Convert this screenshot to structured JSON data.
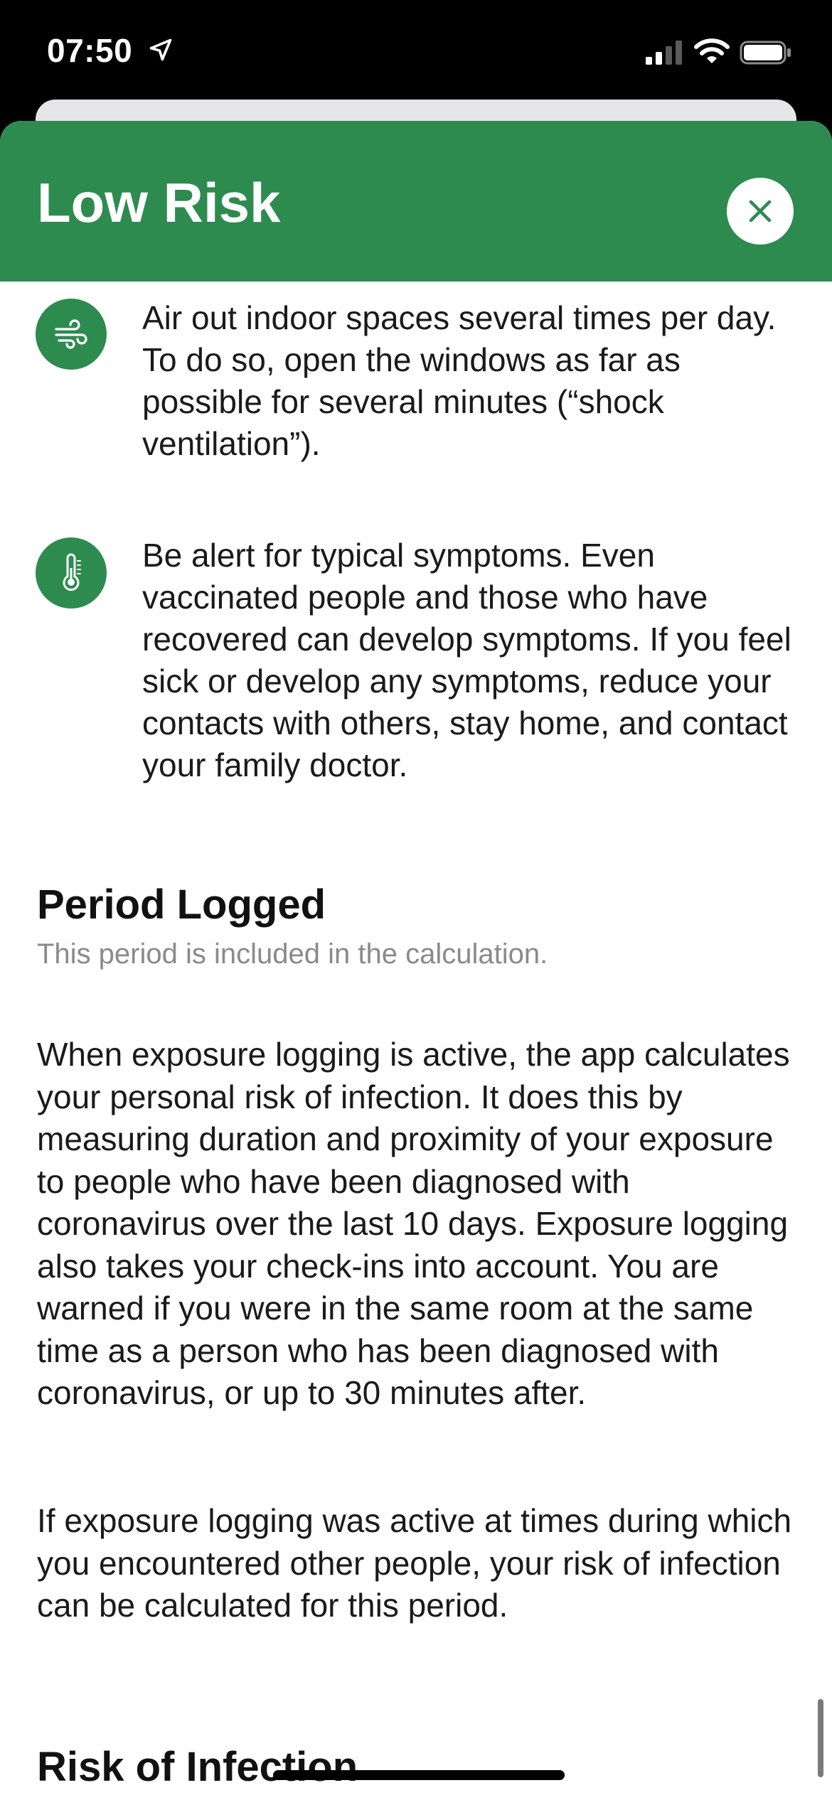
{
  "status_bar": {
    "time": "07:50"
  },
  "sheet": {
    "title": "Low Risk",
    "accent_color": "#2e8b4f"
  },
  "tips": [
    {
      "icon": "ventilation-icon",
      "text": "Air out indoor spaces several times per day. To do so, open the windows as far as possible for several minutes (“shock ventilation”)."
    },
    {
      "icon": "thermometer-icon",
      "text": "Be alert for typical symptoms. Even vaccinated people and those who have recovered can develop symptoms. If you feel sick or develop any symptoms, reduce your contacts with others, stay home, and contact your family doctor."
    }
  ],
  "period_logged": {
    "title": "Period Logged",
    "subtitle": "This period is included in the calculation.",
    "paragraphs": [
      "When exposure logging is active, the app calculates your personal risk of infection. It does this by measuring duration and proximity of your exposure to people who have been diagnosed with coronavirus over the last 10 days. Exposure logging also takes your check-ins into account. You are warned if you were in the same room at the same time as a person who has been diagnosed with coronavirus, or up to 30 minutes after.",
      "If exposure logging was active at times during which you encountered other people, your risk of infection can be calculated for this period."
    ]
  },
  "risk_of_infection": {
    "title": "Risk of Infection"
  }
}
